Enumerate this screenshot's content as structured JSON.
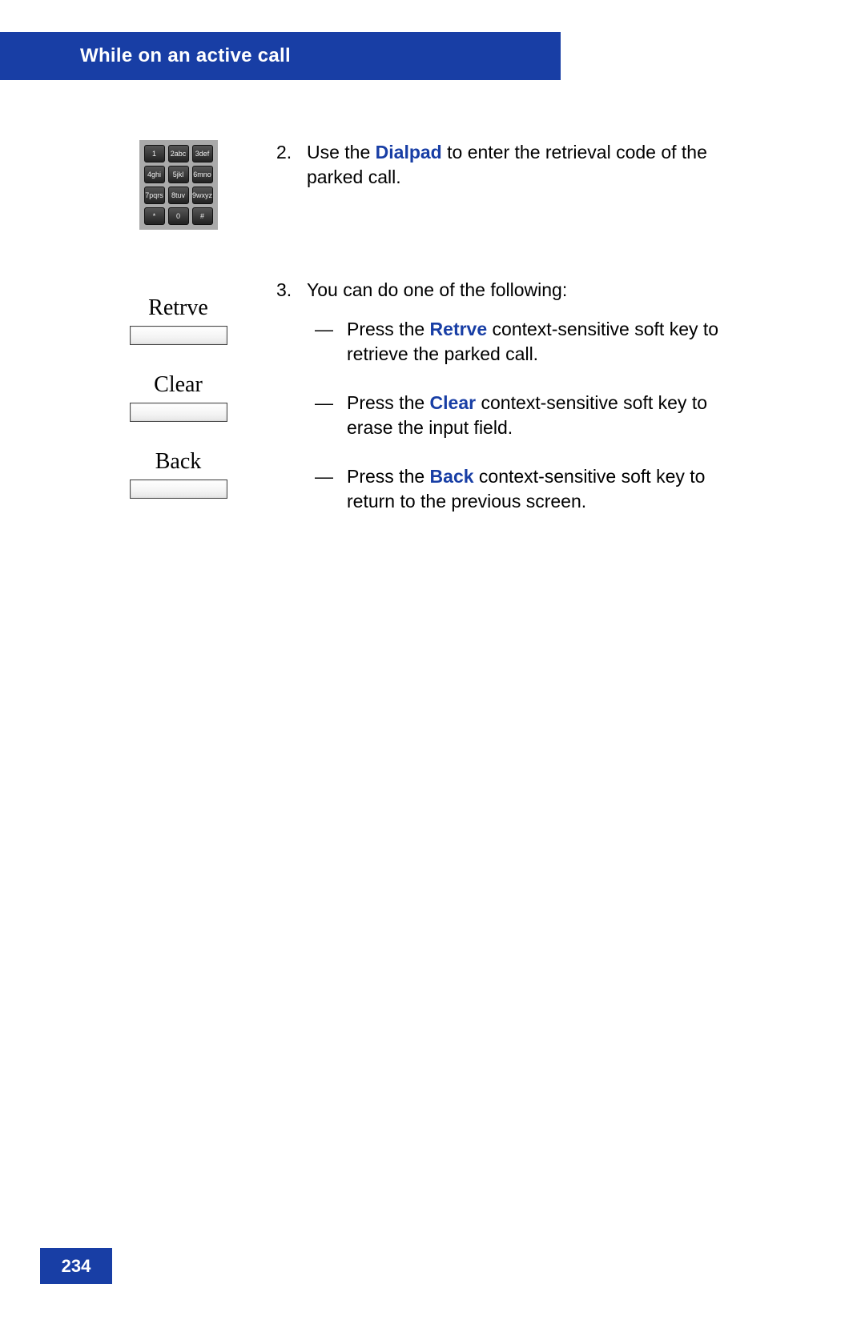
{
  "header": {
    "title": "While on an active call"
  },
  "dialpad": {
    "keys": [
      "1",
      "2abc",
      "3def",
      "4ghi",
      "5jkl",
      "6mno",
      "7pqrs",
      "8tuv",
      "9wxyz",
      "*",
      "0",
      "#"
    ]
  },
  "step2": {
    "num": "2.",
    "prefix": "Use the ",
    "bold": "Dialpad",
    "suffix": " to enter the retrieval code of the parked call."
  },
  "step3": {
    "num": "3.",
    "intro": "You can do one of the following:",
    "softkeys": [
      {
        "label": "Retrve"
      },
      {
        "label": "Clear"
      },
      {
        "label": "Back"
      }
    ],
    "items": [
      {
        "pre": "Press the ",
        "bold": "Retrve",
        "post": " context-sensitive soft key to retrieve the parked call."
      },
      {
        "pre": "Press the ",
        "bold": "Clear",
        "post": " context-sensitive soft key to erase the input field."
      },
      {
        "pre": "Press the ",
        "bold": "Back",
        "post": " context-sensitive soft key to return to the previous screen."
      }
    ],
    "dash": "—"
  },
  "pageNumber": "234"
}
